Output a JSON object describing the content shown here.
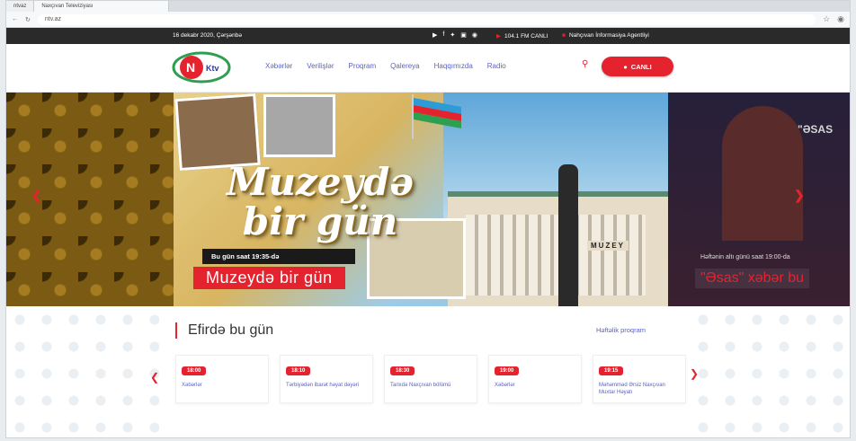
{
  "browser": {
    "tabs": [
      "ntvaz",
      "Naxçıvan Televiziyası"
    ],
    "url": "ntv.az",
    "icons": [
      "back-icon",
      "reload-icon",
      "star-icon",
      "account-icon"
    ]
  },
  "topbar": {
    "date": "16 dekabr 2020, Çərşənbə",
    "social_icons": [
      "youtube-icon",
      "facebook-icon",
      "twitter-icon",
      "instagram-icon",
      "globe-icon"
    ],
    "radio": "104.1 FM CANLI",
    "agency": "Nahçıvan İnformasiya Agentliyi"
  },
  "nav": {
    "logo": "NTV",
    "menu": [
      "Xəbərlər",
      "Verilişlər",
      "Proqram",
      "Qalereya",
      "Haqqımızda",
      "Radio"
    ],
    "live_label": "CANLI"
  },
  "slider": {
    "title_line1": "Muzeydə",
    "title_line2": "bir gün",
    "time_text": "Bu gün saat 19:35-də",
    "show_name": "Muzeydə bir gün",
    "museum_sign": "MUZEY",
    "right_caption": "Həftənin altı günü saat 19:00-da",
    "right_title": "\"Əsas\" xəbər bu",
    "right_mark": "\"ƏSAS"
  },
  "schedule": {
    "title": "Efirdə bu gün",
    "weekly_link": "Həftəlik proqram",
    "items": [
      {
        "time": "18:00",
        "name": "Xəbərlər"
      },
      {
        "time": "18:10",
        "name": "Tərbiyədən ibarət həyat dəyəri"
      },
      {
        "time": "18:30",
        "name": "Tarixdə Naxçıvan bölümü"
      },
      {
        "time": "19:00",
        "name": "Xəbərlər"
      },
      {
        "time": "19:15",
        "name": "Məhəmməd Ərsiz Naxçıvan Muxtar Həyatı"
      }
    ]
  },
  "colors": {
    "accent": "#e4232f",
    "nav_link": "#5a63c4"
  }
}
